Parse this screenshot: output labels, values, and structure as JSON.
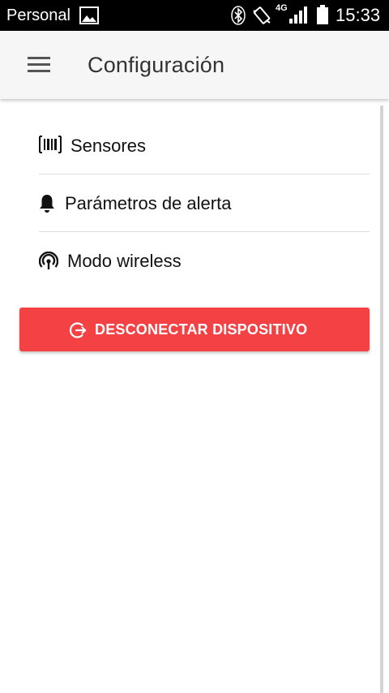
{
  "status_bar": {
    "carrier": "Personal",
    "network": "4G",
    "time": "15:33"
  },
  "app_bar": {
    "title": "Configuración",
    "menu_icon": "menu-icon"
  },
  "menu": {
    "items": [
      {
        "label": "Sensores",
        "icon": "barcode-icon"
      },
      {
        "label": "Parámetros de alerta",
        "icon": "bell-icon"
      },
      {
        "label": "Modo wireless",
        "icon": "wireless-icon"
      }
    ]
  },
  "disconnect": {
    "label": "DESCONECTAR DISPOSITIVO",
    "icon": "logout-icon",
    "color": "#f44144"
  },
  "colors": {
    "status_bar": "#000000",
    "app_bar": "#f6f6f6",
    "accent": "#f44144"
  }
}
